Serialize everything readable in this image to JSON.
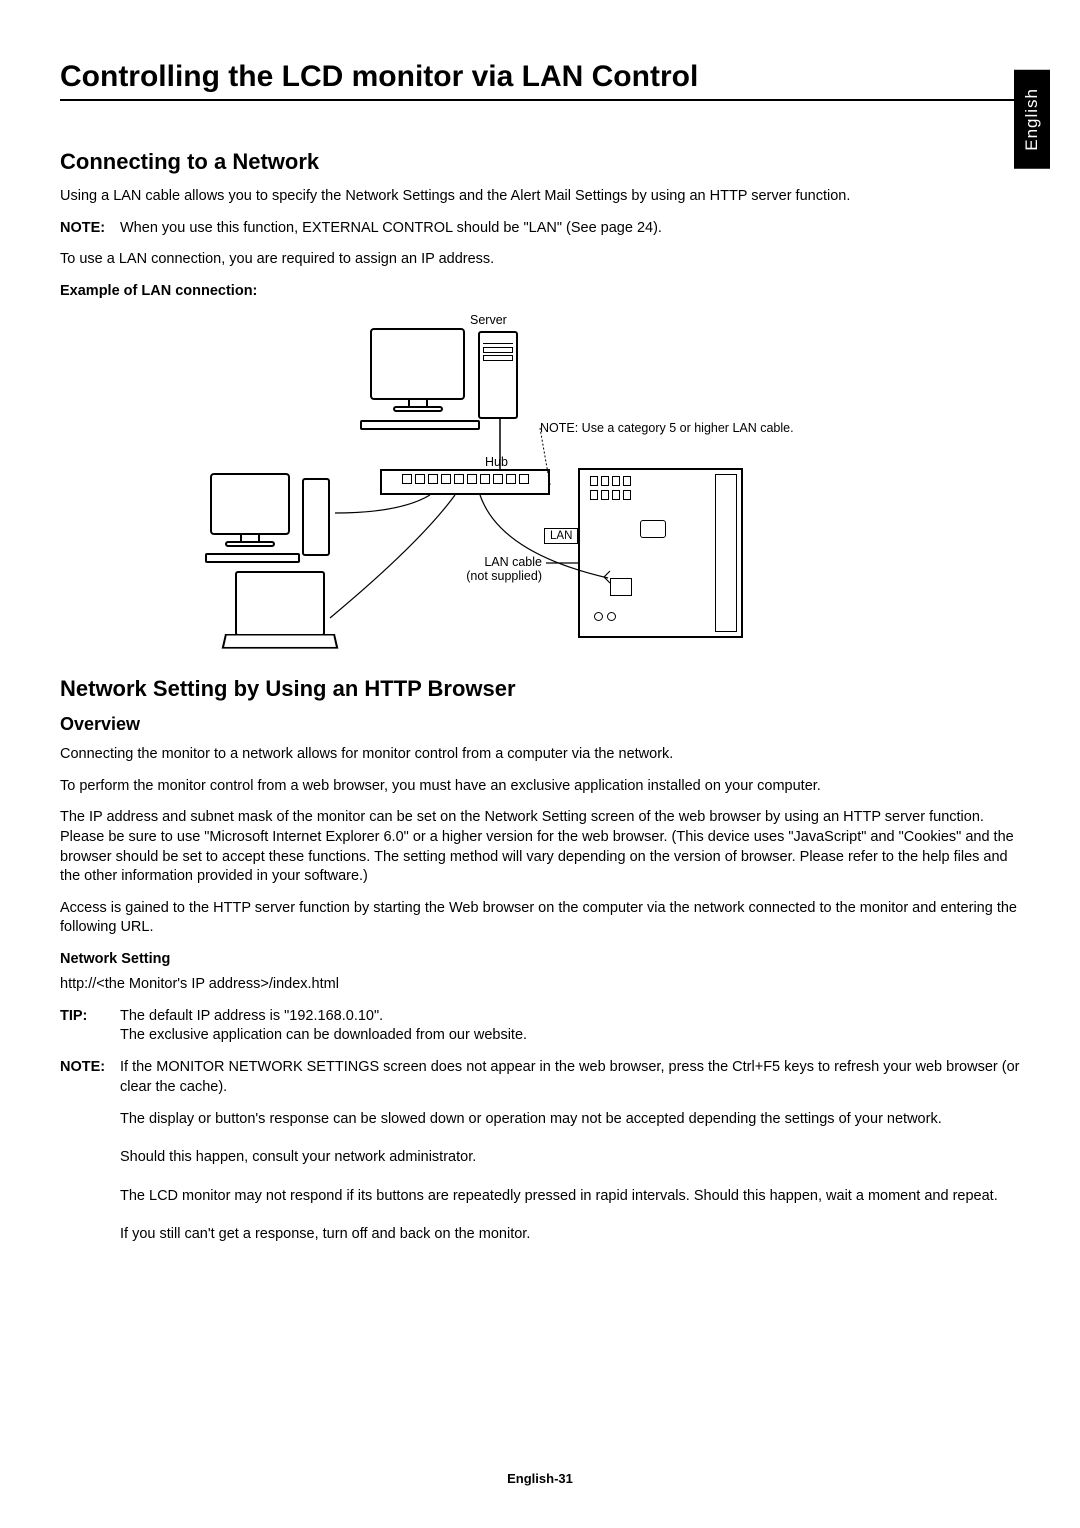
{
  "lang_tab": "English",
  "title": "Controlling the LCD monitor via LAN Control",
  "sec1": {
    "heading": "Connecting to a Network",
    "p1": "Using a LAN cable allows you to specify the Network Settings and the Alert Mail Settings by using an HTTP server function.",
    "note_label": "NOTE:",
    "note_text": "When you use this function, EXTERNAL CONTROL should be \"LAN\" (See page 24).",
    "p2": "To use a LAN connection, you are required to assign an IP address.",
    "example_label": "Example of LAN connection:"
  },
  "diagram": {
    "server": "Server",
    "hub": "Hub",
    "lan": "LAN",
    "lan_cable": "LAN cable",
    "not_supplied": "(not supplied)",
    "cable_note": "NOTE: Use a category 5 or higher LAN cable."
  },
  "sec2": {
    "heading": "Network Setting by Using an HTTP Browser",
    "sub": "Overview",
    "p1": "Connecting the monitor to a network allows for monitor control from a computer via the network.",
    "p2": "To perform the monitor control from a web browser, you must have an exclusive application installed on your computer.",
    "p3": "The IP address and subnet mask of the monitor can be set on the Network Setting screen of the web browser by using an HTTP server function. Please be sure to use \"Microsoft Internet Explorer 6.0\" or a higher version for the web browser. (This device uses \"JavaScript\" and \"Cookies\" and the browser should be set to accept these functions. The setting method will vary depending on the version of browser. Please refer to the help files and the other information provided in your software.)",
    "p4": "Access is gained to the HTTP server function by starting the Web browser on the computer via the network connected to the monitor and entering the following URL.",
    "netset_label": "Network Setting",
    "url": "http://<the Monitor's IP address>/index.html",
    "tip_label": "TIP:",
    "tip_text": "The default IP address is \"192.168.0.10\".\nThe exclusive application can be downloaded from our website.",
    "note2_label": "NOTE:",
    "note2_text": "If the MONITOR NETWORK SETTINGS screen does not appear in the web browser, press the Ctrl+F5 keys to refresh your web browser (or clear the cache).",
    "para_a": "The display or button's response can be slowed down or operation may not be accepted depending the settings of your network.",
    "para_b": "Should this happen, consult your network administrator.",
    "para_c": "The LCD monitor may not respond if its buttons are repeatedly pressed in rapid intervals. Should this happen, wait a moment and repeat.",
    "para_d": "If you still can't get a response, turn off and back on the monitor."
  },
  "page_number": "English-31"
}
